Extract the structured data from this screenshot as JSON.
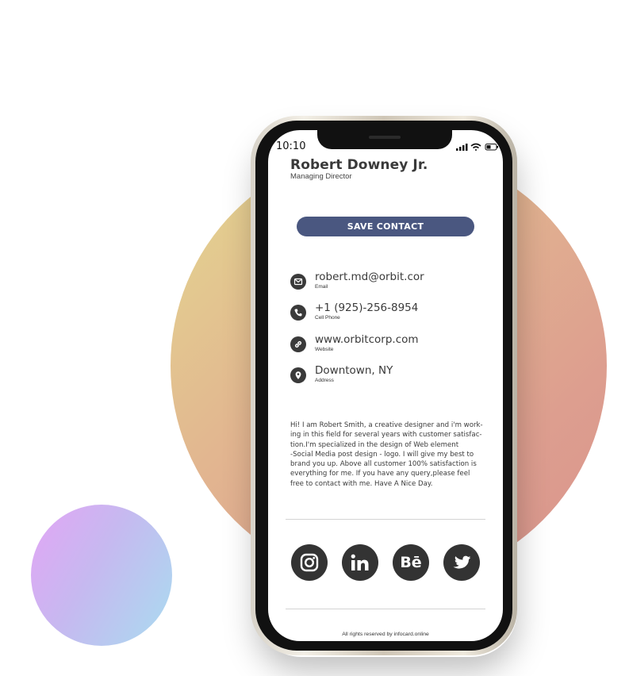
{
  "phone": {
    "time": "10:10"
  },
  "profile": {
    "name": "Robert Downey Jr.",
    "title": "Managing Director"
  },
  "actions": {
    "save_contact": "SAVE CONTACT"
  },
  "contacts": [
    {
      "value": "robert.md@orbit.cor",
      "label": "Email",
      "icon": "mail-icon"
    },
    {
      "value": "+1 (925)-256-8954",
      "label": "Cell Phone",
      "icon": "phone-icon"
    },
    {
      "value": "www.orbitcorp.com",
      "label": "Website",
      "icon": "link-icon"
    },
    {
      "value": "Downtown, NY",
      "label": "Address",
      "icon": "location-pin-icon"
    }
  ],
  "bio": [
    "Hi! I am Robert Smith, a creative designer and i'm work-",
    "ing in this field for several years with customer satisfac-",
    "tion.I'm specialized in the design of Web element",
    "-Social Media post design - logo. I will give my best to",
    "brand you up. Above all customer 100% satisfaction is",
    "everything for me. If you have any query,please feel",
    "free to contact with me. Have A Nice Day."
  ],
  "social": {
    "behance_label": "Bē",
    "icons": [
      "instagram-icon",
      "linkedin-icon",
      "behance-icon",
      "twitter-icon"
    ]
  },
  "footer": {
    "text": "All rights reserved by infocard.online"
  },
  "colors": {
    "button": "#4a5780",
    "icon_dark": "#333333",
    "circle_warm_start": "#e4d88f",
    "circle_warm_end": "#d9948d",
    "circle_cool_start": "#e3a5f5",
    "circle_cool_end": "#a9dcf0"
  }
}
